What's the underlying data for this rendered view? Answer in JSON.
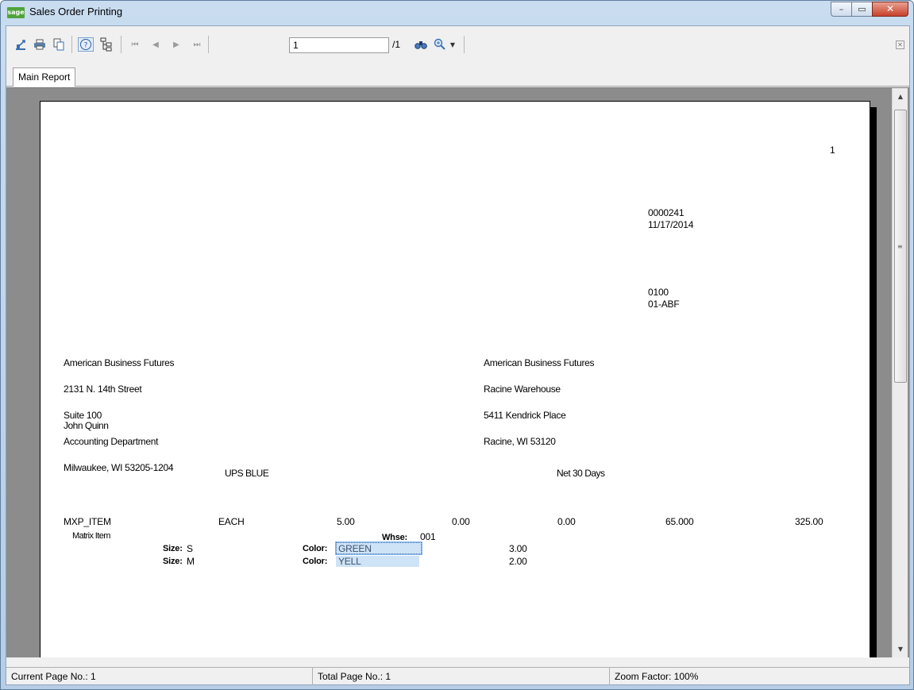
{
  "window": {
    "app_icon_text": "sage",
    "title": "Sales Order Printing",
    "minimize_glyph": "–",
    "maximize_glyph": "▭",
    "close_glyph": "✕"
  },
  "toolbar": {
    "page_number_value": "1",
    "page_total": "/1",
    "icons": [
      "export-icon",
      "print-icon",
      "copy-icon",
      "help-icon",
      "group-tree-icon",
      "first-page-icon",
      "previous-page-icon",
      "next-page-icon",
      "last-page-icon",
      "find-icon",
      "zoom-icon",
      "zoom-dropdown-icon",
      "close-viewer-icon"
    ]
  },
  "tabs": [
    {
      "label": "Main Report"
    }
  ],
  "report": {
    "page_number": "1",
    "order_number": "0000241",
    "order_date": "11/17/2014",
    "customer_no": "0100",
    "customer_code": "01-ABF",
    "bill_to": [
      "American Business Futures",
      "2131 N. 14th Street",
      "Suite 100",
      "Accounting Department",
      "Milwaukee, WI 53205-1204"
    ],
    "ship_to": [
      "American Business Futures",
      "Racine Warehouse",
      "5411 Kendrick Place",
      "Racine, WI 53120"
    ],
    "contact": "John Quinn",
    "ship_via": "UPS BLUE",
    "terms": "Net 30 Days",
    "line": {
      "item": "MXP_ITEM",
      "unit": "EACH",
      "ordered": "5.00",
      "shipped": "0.00",
      "backordered": "0.00",
      "price": "65.000",
      "amount": "325.00",
      "description": "Matrix Item",
      "whse_label": "Whse:",
      "whse_value": "001"
    },
    "matrix_rows": [
      {
        "size_label": "Size:",
        "size_value": "S",
        "color_label": "Color:",
        "color_value": "GREEN",
        "qty": "3.00"
      },
      {
        "size_label": "Size:",
        "size_value": "M",
        "color_label": "Color:",
        "color_value": "YELL",
        "qty": "2.00"
      }
    ]
  },
  "status": {
    "current_page": "Current Page No.: 1",
    "total_page": "Total Page No.: 1",
    "zoom": "Zoom Factor: 100%"
  }
}
